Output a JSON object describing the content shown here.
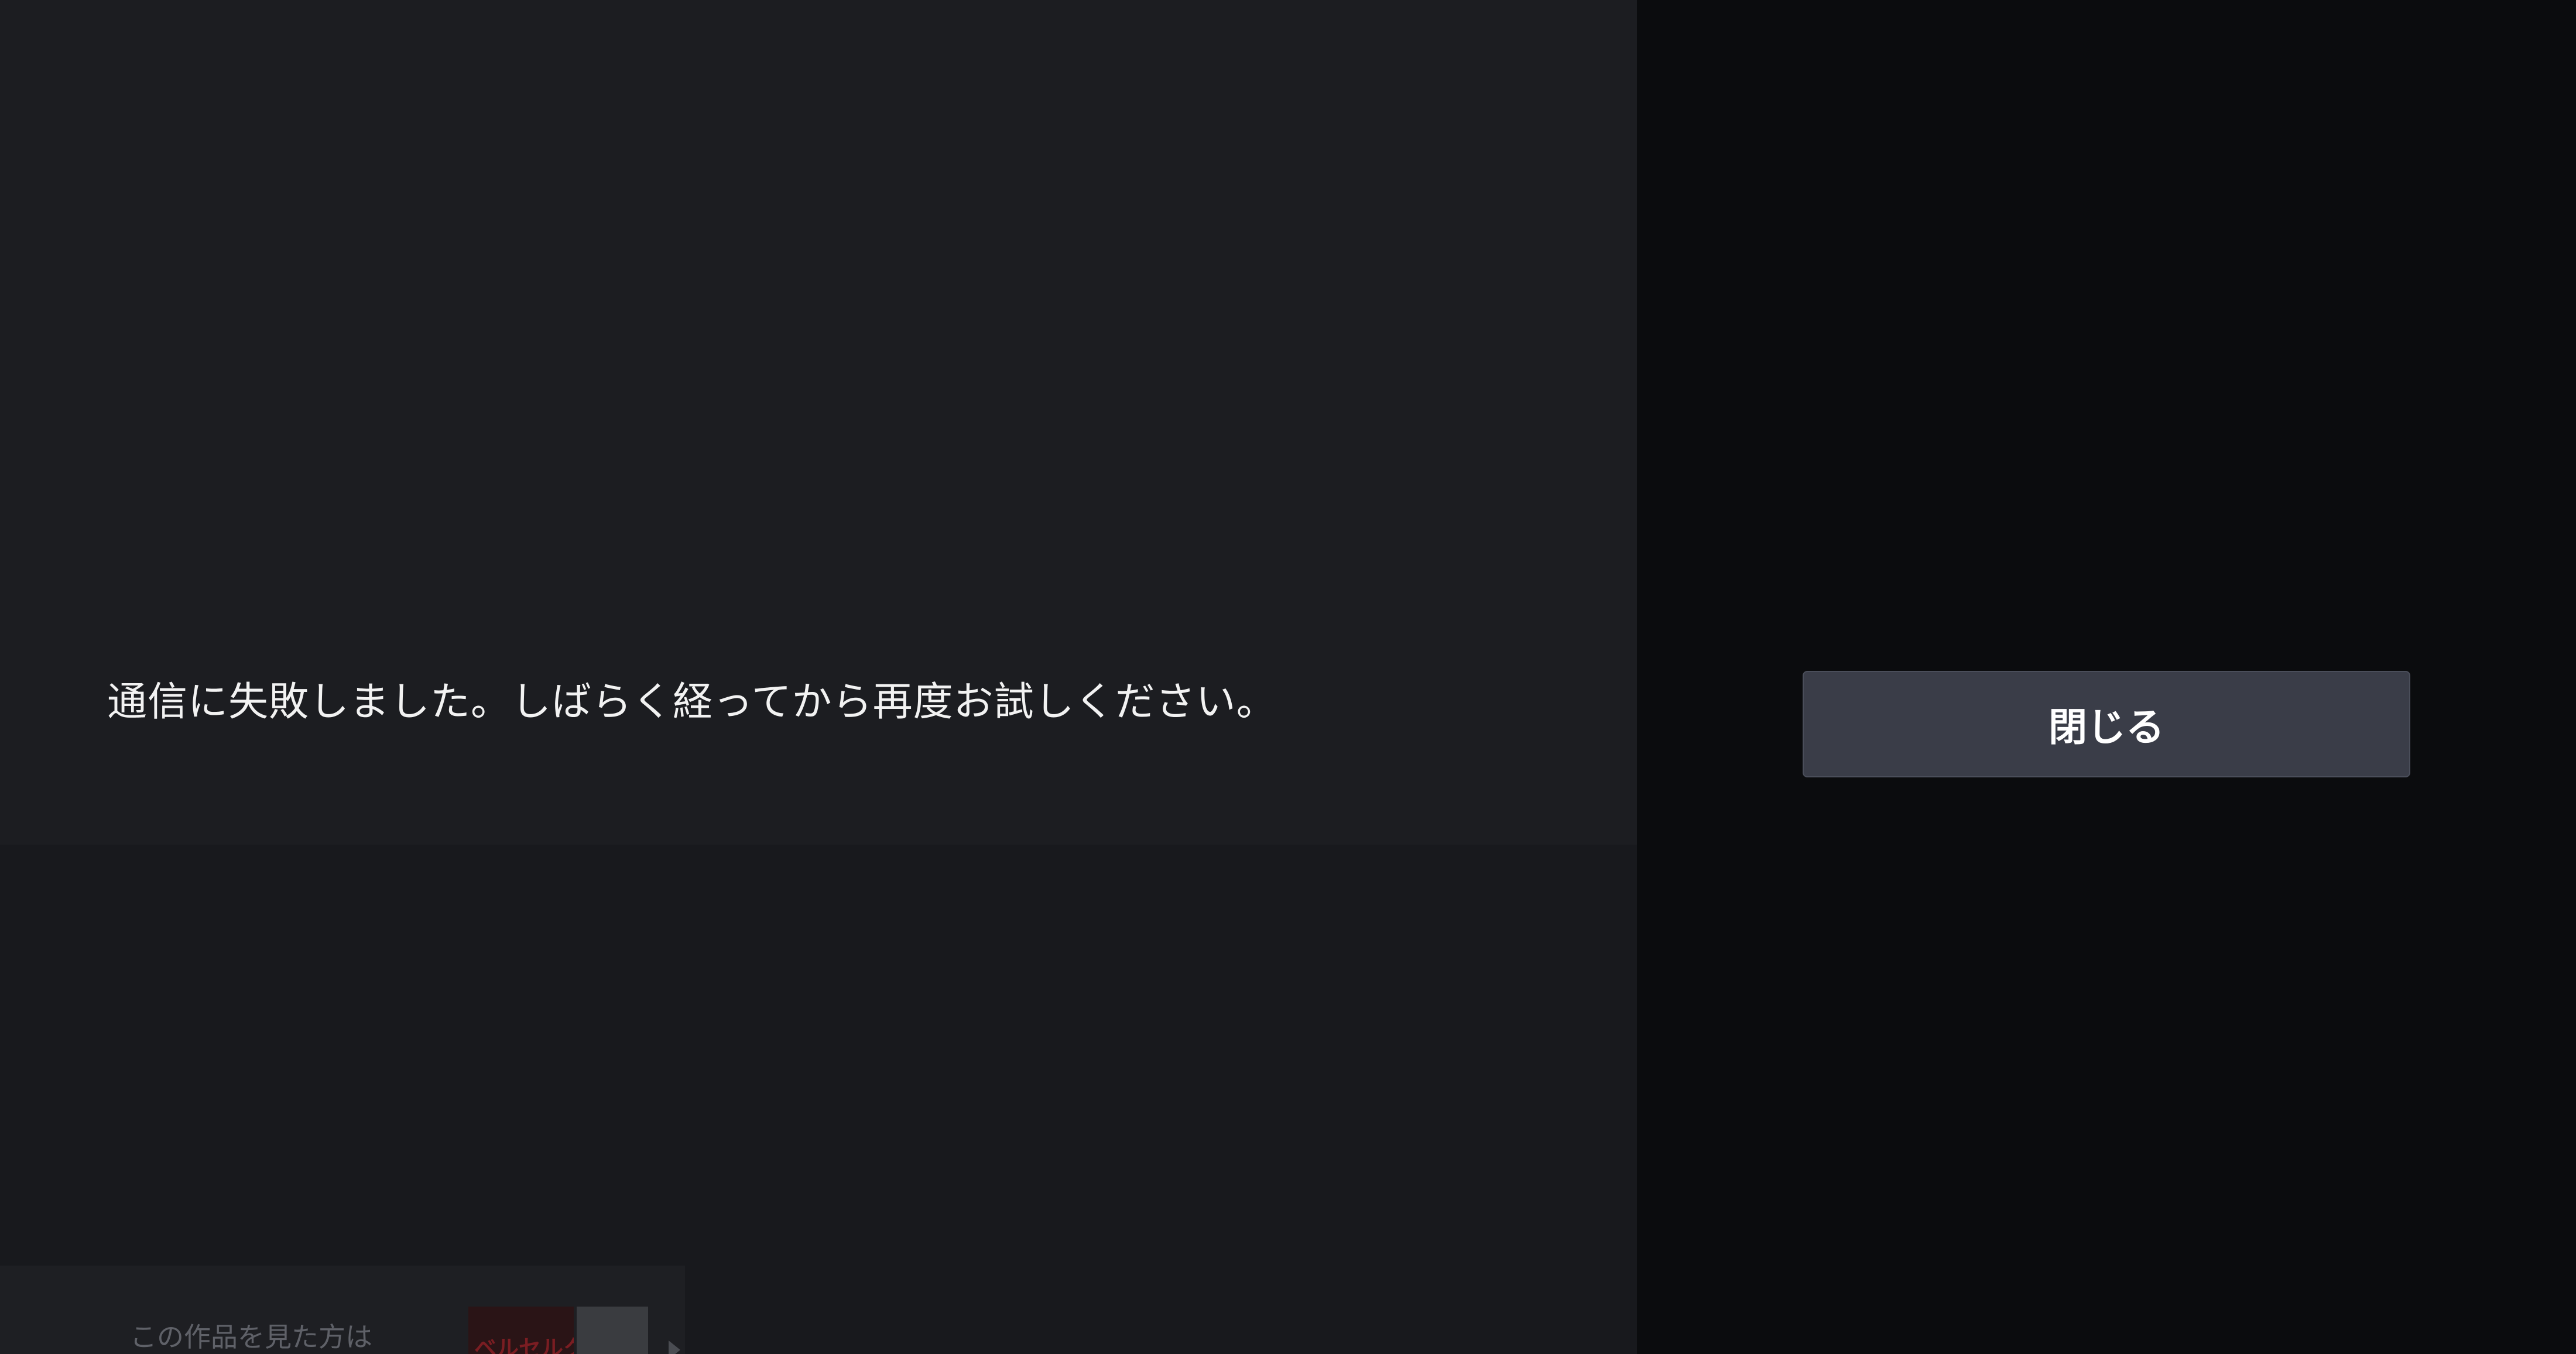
{
  "error": {
    "message": "通信に失敗しました。しばらく経ってから再度お試しください。"
  },
  "actions": {
    "close_label": "閉じる"
  },
  "recommendations": {
    "label": "この作品を見た方は",
    "thumbnail_title": "ベルセルク"
  },
  "colors": {
    "panel_background": "#1c1d21",
    "right_background": "#0b0c0e",
    "button_background": "#3a3d48",
    "text": "#f2f2f2"
  }
}
